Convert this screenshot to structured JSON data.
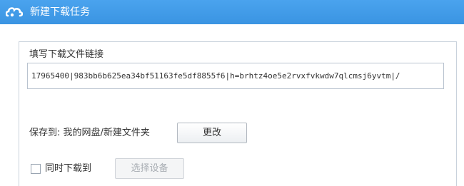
{
  "window": {
    "title": "新建下载任务",
    "accent_color": "#3d97e4"
  },
  "form": {
    "link_label": "填写下载文件链接",
    "link_value": "17965400|983bb6b625ea34bf51163fe5df8855f6|h=brhtz4oe5e2rvxfvkwdw7qlcmsj6yvtm|/",
    "save_to_label": "保存到: 我的网盘/新建文件夹",
    "change_button": "更改",
    "sync_download_label": "同时下载到",
    "sync_checked": false,
    "select_device_button": "选择设备"
  },
  "icons": {
    "app": "cloud-app-icon"
  }
}
